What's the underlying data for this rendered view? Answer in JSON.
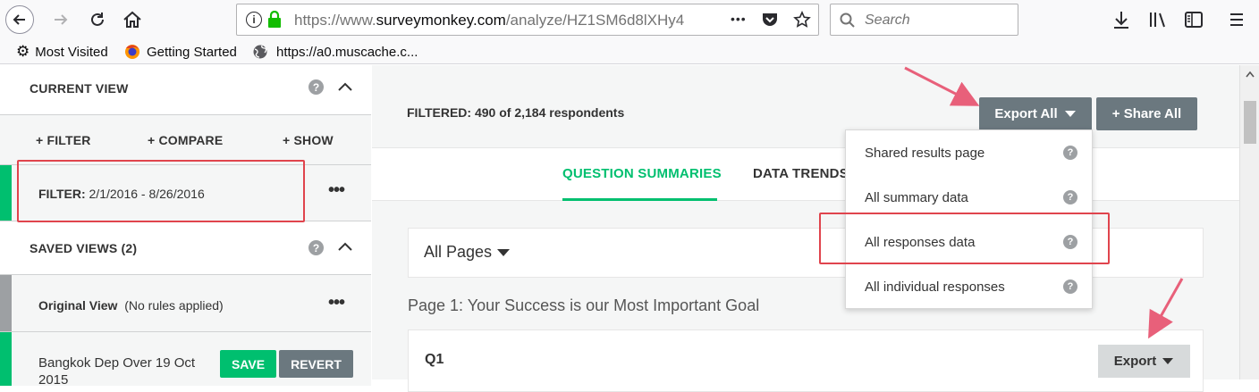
{
  "browser": {
    "url_secure_prefix": "https://www.",
    "url_domain": "surveymonkey.com",
    "url_path": "/analyze/HZ1SM6d8lXHy4",
    "search_placeholder": "Search",
    "url_more": "•••",
    "bookmarks": [
      {
        "label": "Most Visited",
        "icon": "gear-icon"
      },
      {
        "label": "Getting Started",
        "icon": "firefox-icon"
      },
      {
        "label": "https://a0.muscache.c...",
        "icon": "globe-icon"
      }
    ]
  },
  "sidebar": {
    "current_view": {
      "title": "CURRENT VIEW",
      "help": "?"
    },
    "actions": {
      "filter": "+ FILTER",
      "compare": "+ COMPARE",
      "show": "+ SHOW"
    },
    "filter_rule": {
      "label": "FILTER:",
      "value": "2/1/2016 - 8/26/2016",
      "more": "•••"
    },
    "saved_views": {
      "title": "SAVED VIEWS (2)",
      "help": "?"
    },
    "original_view": {
      "name": "Original View",
      "note": "(No rules applied)",
      "more": "•••"
    },
    "custom_view": {
      "name": "Bangkok Dep Over 19 Oct 2015",
      "save_label": "SAVE",
      "revert_label": "REVERT"
    }
  },
  "main": {
    "filtered_label": "FILTERED:",
    "filtered_text": "490 of 2,184 respondents",
    "export_all_label": "Export All",
    "share_all_label": "+ Share All",
    "tabs": [
      {
        "label": "QUESTION SUMMARIES",
        "active": true
      },
      {
        "label": "DATA TRENDS",
        "active": false
      }
    ],
    "pages_select": "All Pages",
    "page_title": "Page 1: Your Success is our Most Important Goal",
    "question_label": "Q1",
    "export_label": "Export"
  },
  "export_menu": {
    "items": [
      {
        "label": "Shared results page",
        "help": "?"
      },
      {
        "label": "All summary data",
        "help": "?"
      },
      {
        "label": "All responses data",
        "help": "?",
        "highlighted": true
      },
      {
        "label": "All individual responses",
        "help": "?"
      }
    ]
  },
  "colors": {
    "brand_green": "#00bf6f",
    "annotation_red": "#e0444d",
    "button_gray": "#6b787f"
  }
}
